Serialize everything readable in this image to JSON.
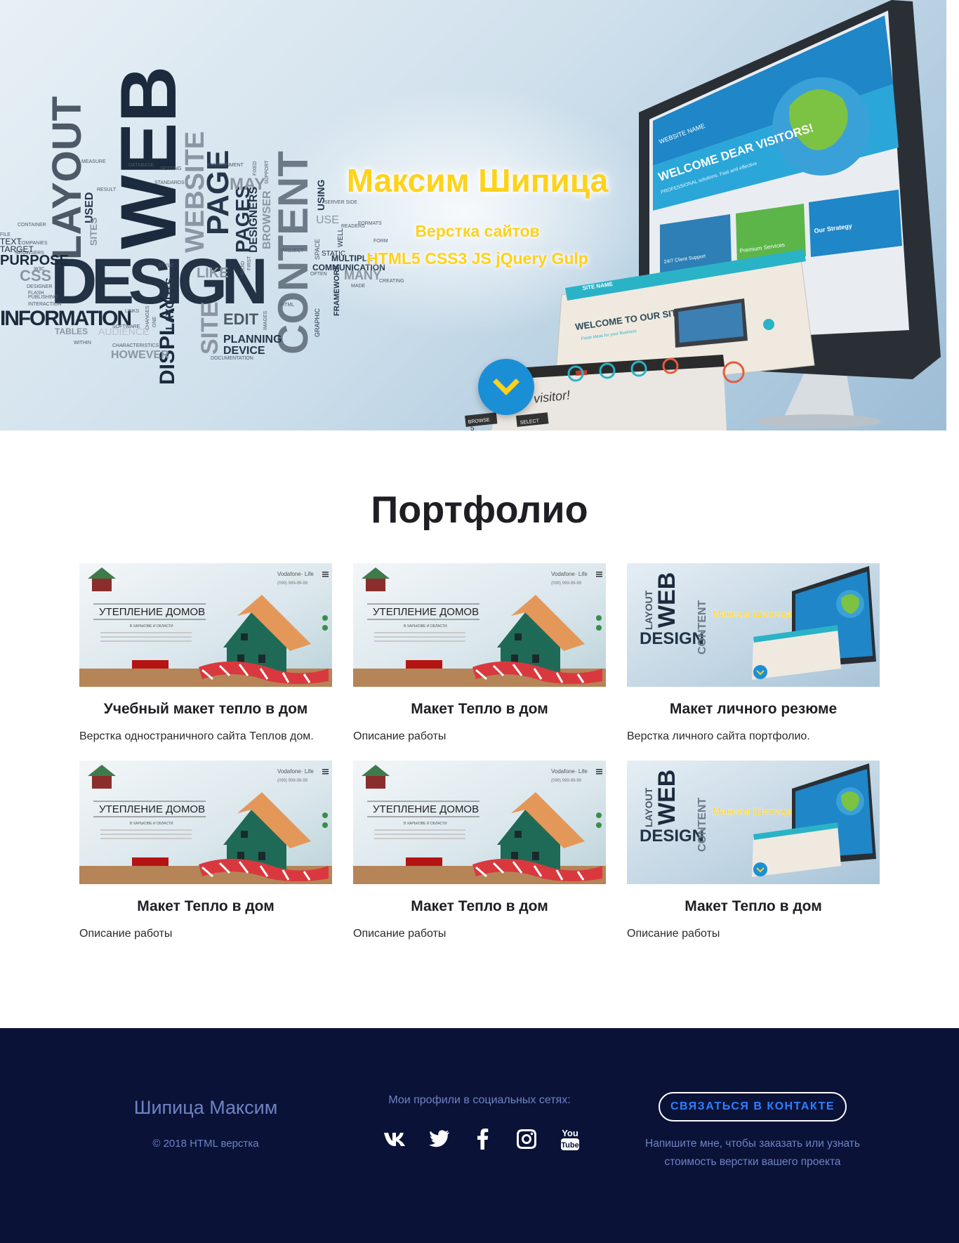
{
  "hero": {
    "title": "Максим Шипица",
    "subtitle_line1": "Верстка сайтов",
    "subtitle_line2": "HTML5 CSS3 JS jQuery Gulp",
    "scroll_icon": "chevron-down-icon",
    "banner_words": {
      "big": [
        "WEB",
        "DESIGN",
        "LAYOUT",
        "INFORMATION",
        "CONTENT",
        "WEBSITE",
        "PAGE",
        "PAGES",
        "DISPLAY",
        "SITE"
      ],
      "medium": [
        "PURPOSE",
        "CSS",
        "MAY",
        "EDIT",
        "PLANNING",
        "DEVICE",
        "HOWEVER",
        "COMMUNICATION",
        "MANY",
        "USING",
        "TABLES",
        "USED",
        "SITES",
        "LIKE",
        "DESIGNERS",
        "BROWSER",
        "LAYOUTS",
        "FRAMEWORK",
        "MULTIPLE"
      ],
      "small": [
        "DATABASE",
        "RESULT",
        "ENVIRONMENT",
        "FIXED",
        "SUPPORT",
        "SETTING",
        "MEASURE",
        "BROWSERS",
        "TARGET",
        "TEXT",
        "W3C",
        "PUBLISHING",
        "INTERACTION",
        "SOFTWARE",
        "CHARACTERISTICS",
        "CHANGES",
        "ONE",
        "FIRST",
        "FLUID",
        "IMAGES",
        "HTML",
        "OFTEN",
        "PROJECT",
        "STATIC",
        "SPACE",
        "WELL",
        "FORM",
        "FORMATS",
        "READERS",
        "CREATING",
        "MADE",
        "SERVER SIDE",
        "DOCUMENTATION",
        "GRAPHIC",
        "STANDARDS",
        "AUDIENCE",
        "STYLE",
        "FILE",
        "CONTAINER",
        "COMPANIES",
        "DESIGNER",
        "FLASH",
        "LINKS",
        "USE",
        "WITHIN"
      ]
    },
    "screen_texts": {
      "monitor_welcome": "WELCOME DEAR VISITORS!",
      "monitor_sub": "PROFESSIONAL solutions. Fast and effective",
      "monitor_site": "WEBSITE NAME",
      "panel1": "24/7 Client Support",
      "panel2": "Premium Services",
      "panel3": "Our Strategy",
      "laptop_site": "SITE NAME",
      "laptop_welcome": "WELCOME TO OUR SITE",
      "laptop_sub": "Fresh Ideas for your Business",
      "bottom_text": "dear visitor!",
      "bottom_btn1": "BROWSE",
      "bottom_btn2": "SELECT",
      "bottom_btn3": "5"
    }
  },
  "portfolio": {
    "title": "Портфолио",
    "items": [
      {
        "title": "Учебный макет тепло в дом",
        "desc": "Верстка одностраничного сайта Теплов дом.",
        "thumb": "house"
      },
      {
        "title": "Макет Тепло в дом",
        "desc": "Описание работы",
        "thumb": "house"
      },
      {
        "title": "Макет личного резюме",
        "desc": "Верстка личного сайта портфолио.",
        "thumb": "web"
      },
      {
        "title": "Макет Тепло в дом",
        "desc": "Описание работы",
        "thumb": "house"
      },
      {
        "title": "Макет Тепло в дом",
        "desc": "Описание работы",
        "thumb": "house"
      },
      {
        "title": "Макет Тепло в дом",
        "desc": "Описание работы",
        "thumb": "web"
      }
    ],
    "house_thumb": {
      "heading": "УТЕПЛЕНИЕ ДОМОВ",
      "subheading": "В ХАРЬКОВЕ И ОБЛАСТИ",
      "operator": "Vodafone",
      "operator_suffix": "· Life",
      "phone": "(099) 999-99-99",
      "menu_icon": "hamburger-icon",
      "logo_icon": "house-logo-icon"
    },
    "web_thumb": {
      "title": "Максим Шипица",
      "word_web": "WEB",
      "word_design": "DESIGN",
      "word_content": "CONTENT",
      "word_layout": "LAYOUT"
    }
  },
  "footer": {
    "name": "Шипица Максим",
    "copyright": "© 2018 HTML верстка",
    "social_label": "Мои профили в социальных сетях:",
    "socials": [
      {
        "name": "vk",
        "icon": "vk-icon"
      },
      {
        "name": "twitter",
        "icon": "twitter-icon"
      },
      {
        "name": "facebook",
        "icon": "facebook-icon"
      },
      {
        "name": "instagram",
        "icon": "instagram-icon"
      },
      {
        "name": "youtube",
        "icon": "youtube-icon",
        "label_top": "You",
        "label_bottom": "Tube"
      }
    ],
    "contact_button": "СВЯЗАТЬСЯ В КОНТАКТЕ",
    "note": "Напишите мне, чтобы заказать или узнать стоимость верстки вашего проекта"
  },
  "colors": {
    "accent_yellow": "#ffd21a",
    "footer_bg": "#0a1237",
    "footer_text": "#6f83c4",
    "button_text": "#2f7fff",
    "scroll_button": "#1b8fd6"
  }
}
